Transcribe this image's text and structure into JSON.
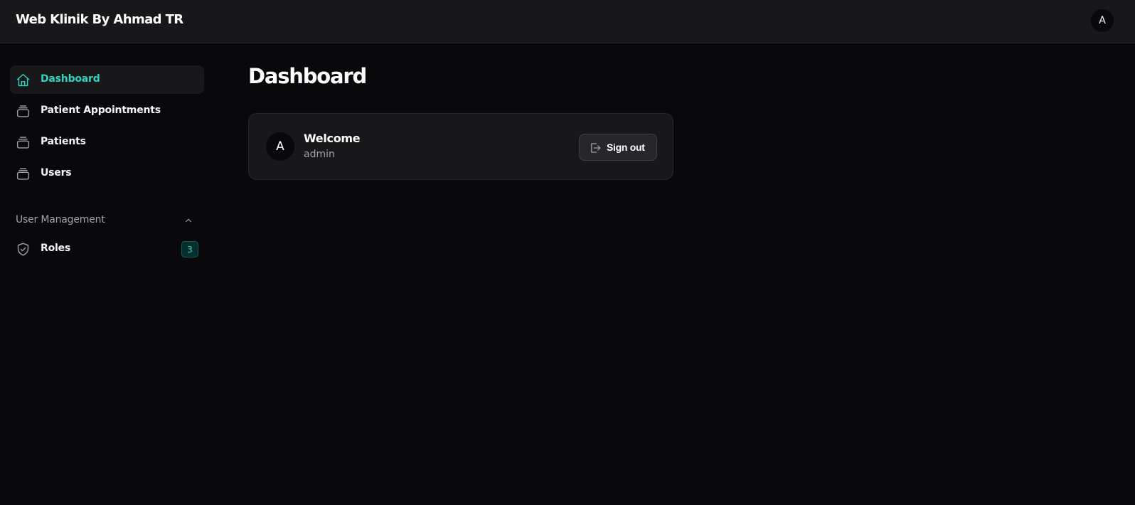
{
  "app": {
    "brand": "Web Klinik By Ahmad TR",
    "user_initial": "A"
  },
  "sidebar": {
    "items": [
      {
        "label": "Dashboard",
        "icon": "home-icon",
        "active": true
      },
      {
        "label": "Patient Appointments",
        "icon": "stack-icon",
        "active": false
      },
      {
        "label": "Patients",
        "icon": "stack-icon",
        "active": false
      },
      {
        "label": "Users",
        "icon": "stack-icon",
        "active": false
      }
    ],
    "group": {
      "label": "User Management",
      "icon": "chevron-up-icon",
      "items": [
        {
          "label": "Roles",
          "icon": "shield-check-icon",
          "badge": "3"
        }
      ]
    }
  },
  "main": {
    "title": "Dashboard",
    "welcome_card": {
      "avatar_initial": "A",
      "heading": "Welcome",
      "username": "admin",
      "signout_label": "Sign out",
      "signout_icon": "sign-out-icon"
    }
  },
  "colors": {
    "accent": "#2dd4bf",
    "background": "#09090b",
    "surface": "#18181b",
    "border": "#27272a",
    "muted_text": "#a1a1aa"
  }
}
